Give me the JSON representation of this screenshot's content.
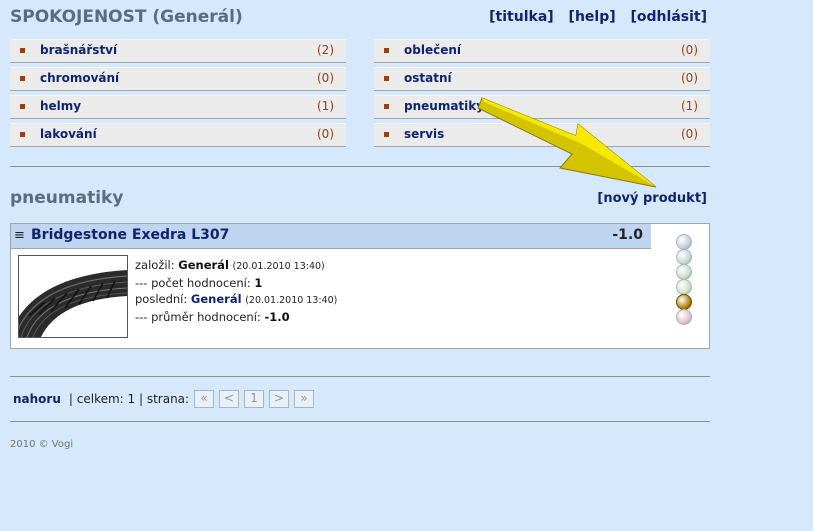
{
  "header": {
    "title": "SPOKOJENOST (Generál)",
    "links": [
      "[titulka]",
      "[help]",
      "[odhlásit]"
    ]
  },
  "categories_left": [
    {
      "label": "brašnářství",
      "count": "(2)"
    },
    {
      "label": "chromování",
      "count": "(0)"
    },
    {
      "label": "helmy",
      "count": "(1)"
    },
    {
      "label": "lakování",
      "count": "(0)"
    }
  ],
  "categories_right": [
    {
      "label": "oblečení",
      "count": "(0)"
    },
    {
      "label": "ostatní",
      "count": "(0)"
    },
    {
      "label": "pneumatiky",
      "count": "(1)"
    },
    {
      "label": "servis",
      "count": "(0)"
    }
  ],
  "section": {
    "title": "pneumatiky",
    "new_product": "[nový produkt]"
  },
  "product": {
    "menu_glyph": "≡",
    "name": "Bridgestone Exedra L307",
    "score": "-1.0",
    "created_label": "založil:",
    "created_by": "Generál",
    "created_date": "(20.01.2010 13:40)",
    "ratings_count_label": "--- počet hodnocení:",
    "ratings_count": "1",
    "last_label": "poslední:",
    "last_by": "Generál",
    "last_date": "(20.01.2010 13:40)",
    "avg_label": "--- průměr hodnocení:",
    "avg": "-1.0"
  },
  "rating_dots": {
    "colors": [
      "#c5cfe0",
      "#c3dcd6",
      "#c8e0c8",
      "#d2e3c4",
      "#b8860b",
      "#e4c5ca"
    ],
    "selected_index": 4
  },
  "pager": {
    "top_link": "nahoru",
    "total_text": "| celkem: 1 | strana:",
    "first": "«",
    "prev": "<",
    "page": "1",
    "next": ">",
    "last": "»"
  },
  "footer": "2010 © Vogi"
}
